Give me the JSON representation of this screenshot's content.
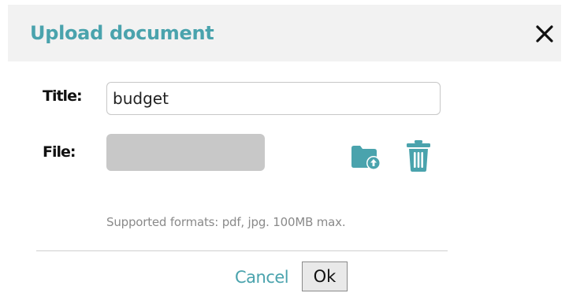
{
  "dialog": {
    "title": "Upload document",
    "close_icon": "close-icon"
  },
  "form": {
    "title_label": "Title:",
    "title_value": "budget",
    "file_label": "File:",
    "folder_upload_icon": "folder-upload-icon",
    "trash_icon": "trash-icon",
    "hint": "Supported formats: pdf, jpg. 100MB max."
  },
  "footer": {
    "cancel_label": "Cancel",
    "ok_label": "Ok"
  },
  "colors": {
    "accent": "#4aa3ad",
    "header_bg": "#f2f2f2",
    "file_box": "#c8c8c8"
  }
}
